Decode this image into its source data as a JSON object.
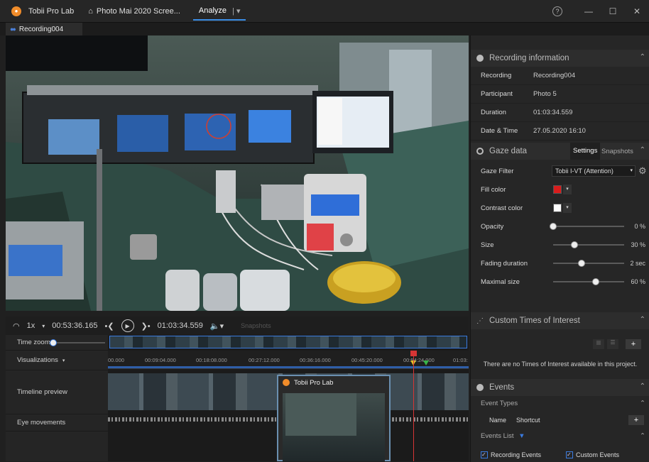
{
  "titlebar": {
    "app_title": "Tobii Pro Lab",
    "project_tab": "Photo Mai 2020 Scree...",
    "analyze_tab": "Analyze",
    "analyze_caret": "|  ▾",
    "help": "?",
    "minimize": "—",
    "maximize": "☐",
    "close": "✕"
  },
  "recording_tab": {
    "label": "Recording004"
  },
  "playback": {
    "speed": "1x",
    "current_time": "00:53:36.165",
    "total_time": "01:03:34.559",
    "snapshots_label": "Snapshots"
  },
  "timeline": {
    "rows": [
      "Time zoom",
      "Visualizations",
      "Timeline preview",
      "Eye movements"
    ],
    "ruler": [
      "00.000",
      "00:09:04.000",
      "00:18:08.000",
      "00:27:12.000",
      "00:36:16.000",
      "00:45:20.000",
      "00:54:24.000",
      "01:03:"
    ],
    "popup_title": "Tobii Pro Lab"
  },
  "recording_info": {
    "title": "Recording information",
    "rows": [
      {
        "key": "Recording",
        "value": "Recording004"
      },
      {
        "key": "Participant",
        "value": "Photo 5"
      },
      {
        "key": "Duration",
        "value": "01:03:34.559"
      },
      {
        "key": "Date & Time",
        "value": "27.05.2020 16:10"
      }
    ]
  },
  "gaze_data": {
    "title": "Gaze data",
    "tab_settings": "Settings",
    "tab_snapshots": "Snapshots",
    "gaze_filter_label": "Gaze Filter",
    "gaze_filter_value": "Tobii I-VT (Attention)",
    "fill_color_label": "Fill color",
    "fill_color": "#d91c1c",
    "contrast_color_label": "Contrast color",
    "contrast_color": "#ffffff",
    "sliders": [
      {
        "label": "Opacity",
        "value": "0",
        "unit": "%",
        "fraction": 0.0
      },
      {
        "label": "Size",
        "value": "30",
        "unit": "%",
        "fraction": 0.3
      },
      {
        "label": "Fading duration",
        "value": "2",
        "unit": "sec",
        "fraction": 0.4
      },
      {
        "label": "Maximal size",
        "value": "60",
        "unit": "%",
        "fraction": 0.6
      }
    ]
  },
  "custom_toi": {
    "title": "Custom Times of Interest",
    "empty_message": "There are no Times of Interest available in this project.",
    "add": "+"
  },
  "events": {
    "title": "Events",
    "event_types_label": "Event Types",
    "col_name": "Name",
    "col_shortcut": "Shortcut",
    "add": "+",
    "events_list_label": "Events List",
    "recording_events": "Recording Events",
    "custom_events": "Custom Events"
  },
  "colors": {
    "accent": "#3a7be0",
    "brand_orange": "#f08c2a"
  }
}
